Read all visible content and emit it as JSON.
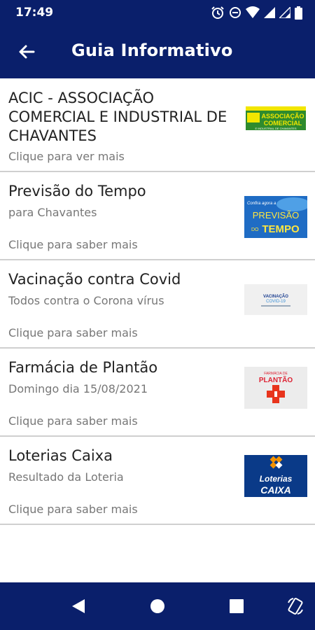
{
  "status": {
    "time": "17:49"
  },
  "header": {
    "title": "Guia Informativo"
  },
  "items": [
    {
      "title": "ACIC - ASSOCIAÇÃO COMERCIAL E INDUSTRIAL DE CHAVANTES",
      "subtitle": "",
      "action": "Clique para ver mais",
      "logo": {
        "line1": "ASSOCIAÇÃO",
        "line2": "COMERCIAL",
        "line3": "E INDUSTRIAL DE CHAVANTES"
      }
    },
    {
      "title": "Previsão do Tempo",
      "subtitle": "para Chavantes",
      "action": "Clique para saber mais",
      "logo": {
        "line1": "Confira agora a",
        "line2": "PREVISÃO",
        "line3": "DO",
        "line4": "TEMPO"
      }
    },
    {
      "title": "Vacinação contra Covid",
      "subtitle": "Todos contra o Corona vírus",
      "action": "Clique para saber mais",
      "logo": {
        "line1": "VACINAÇÃO",
        "line2": "COVID-19"
      }
    },
    {
      "title": "Farmácia de Plantão",
      "subtitle": "Domingo dia 15/08/2021",
      "action": "Clique para saber mais",
      "logo": {
        "line1": "FARMÁCIA DE",
        "line2": "PLANTÃO"
      }
    },
    {
      "title": "Loterias Caixa",
      "subtitle": "Resultado da Loteria",
      "action": "Clique para saber mais",
      "logo": {
        "line1": "Loterias",
        "line2": "CAIXA"
      }
    }
  ],
  "colors": {
    "primary": "#0a1f6b",
    "divider": "#cfcfcf",
    "text": "#222222",
    "secondary_text": "#777777"
  }
}
